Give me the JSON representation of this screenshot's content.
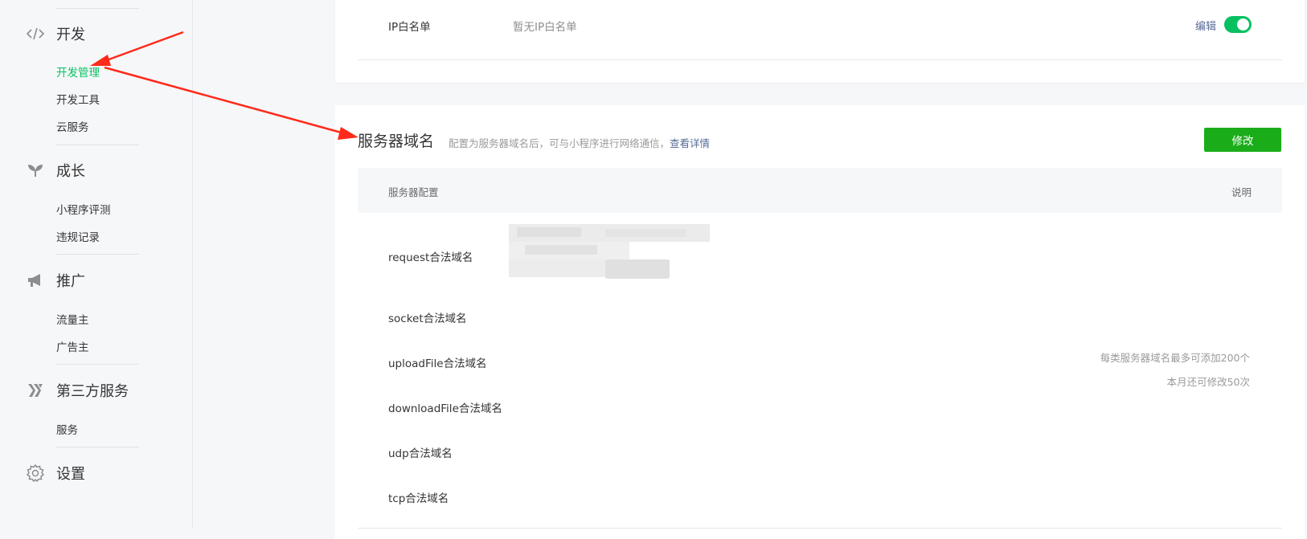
{
  "sidebar": {
    "groups": [
      {
        "label": "开发",
        "icon": "code-icon",
        "items": [
          {
            "label": "开发管理",
            "active": true
          },
          {
            "label": "开发工具",
            "active": false
          },
          {
            "label": "云服务",
            "active": false
          }
        ]
      },
      {
        "label": "成长",
        "icon": "sprout-icon",
        "items": [
          {
            "label": "小程序评测",
            "active": false
          },
          {
            "label": "违规记录",
            "active": false
          }
        ]
      },
      {
        "label": "推广",
        "icon": "megaphone-icon",
        "items": [
          {
            "label": "流量主",
            "active": false
          },
          {
            "label": "广告主",
            "active": false
          }
        ]
      },
      {
        "label": "第三方服务",
        "icon": "third-party-icon",
        "items": [
          {
            "label": "服务",
            "active": false
          }
        ]
      },
      {
        "label": "设置",
        "icon": "gear-icon",
        "items": []
      }
    ]
  },
  "ip_whitelist": {
    "label": "IP白名单",
    "value": "暂无IP白名单",
    "edit_label": "编辑",
    "enabled": true
  },
  "server_domain": {
    "title": "服务器域名",
    "description": "配置为服务器域名后，可与小程序进行网络通信，",
    "detail_link": "查看详情",
    "modify_button": "修改",
    "table": {
      "col_config": "服务器配置",
      "col_note": "说明",
      "rows": [
        {
          "label": "request合法域名"
        },
        {
          "label": "socket合法域名"
        },
        {
          "label": "uploadFile合法域名"
        },
        {
          "label": "downloadFile合法域名"
        },
        {
          "label": "udp合法域名"
        },
        {
          "label": "tcp合法域名"
        }
      ],
      "notes": [
        "每类服务器域名最多可添加200个",
        "本月还可修改50次"
      ]
    }
  },
  "colors": {
    "accent_green": "#07c160",
    "button_green": "#1aad19",
    "link_blue": "#576b95",
    "annotation_red": "#ff2a1a"
  }
}
